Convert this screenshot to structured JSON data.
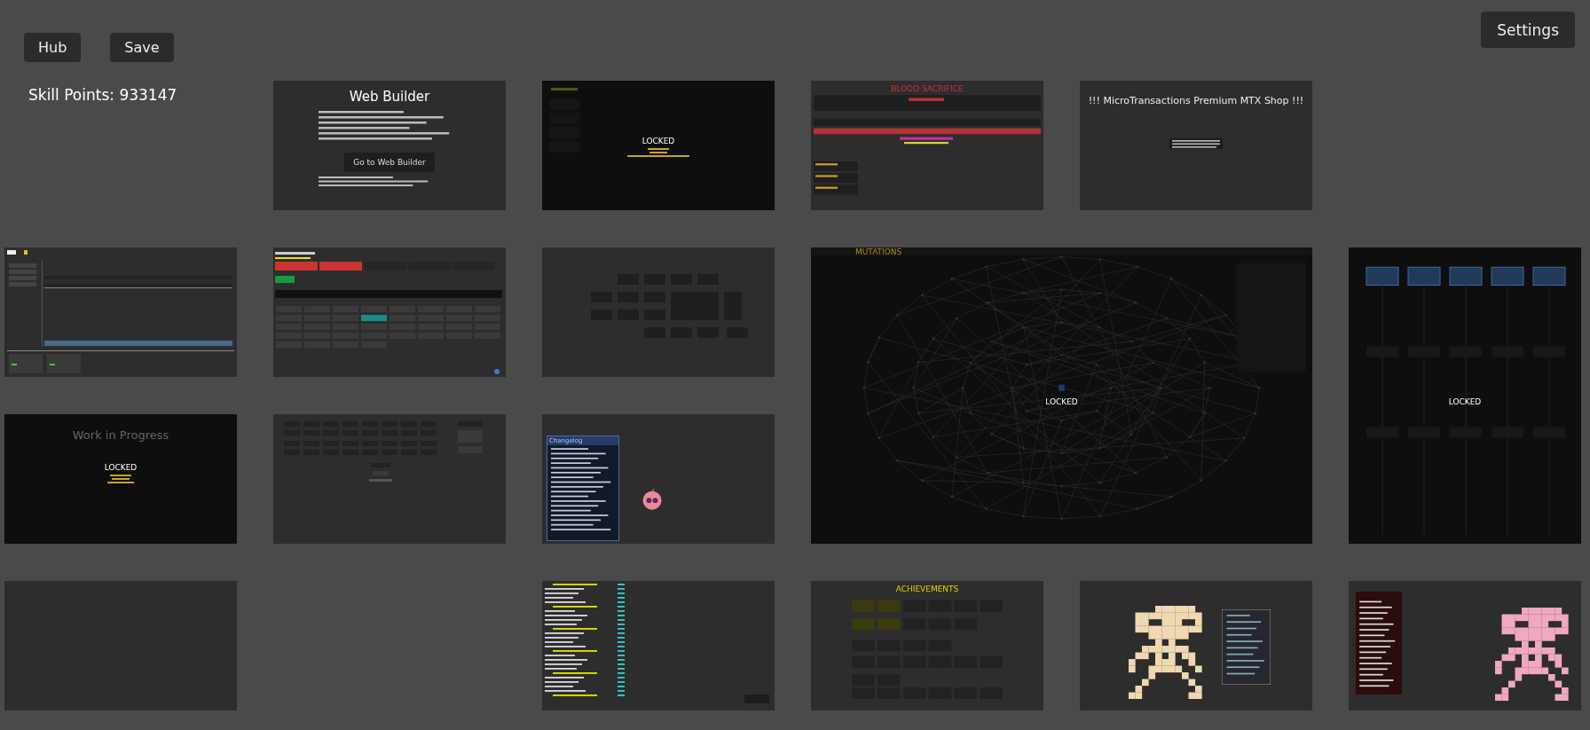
{
  "toolbar": {
    "buttons": [
      "Hub",
      "Save"
    ],
    "settings": "Settings"
  },
  "skill_points": "Skill Points: 933147",
  "pages": [
    {
      "kind": "builder",
      "title": "Web Builder",
      "button": "Go to Web Builder"
    },
    {
      "kind": "prestige",
      "status": "LOCKED"
    },
    {
      "kind": "sacrifice",
      "title": "BLOOD SACRIFICE"
    },
    {
      "kind": "shop",
      "title": "!!! MicroTransactions Premium MTX Shop !!!"
    },
    {
      "kind": "form"
    },
    {
      "kind": "shopgrid"
    },
    {
      "kind": "nodes"
    },
    {
      "kind": "graph",
      "title": "MUTATIONS",
      "status": "LOCKED"
    },
    {
      "kind": "columns",
      "status": "LOCKED"
    },
    {
      "kind": "wip",
      "title": "Work in Progress",
      "status": "LOCKED"
    },
    {
      "kind": "grid"
    },
    {
      "kind": "changelog",
      "title": "Changelog"
    },
    {
      "kind": "empty"
    },
    {
      "kind": "textlist"
    },
    {
      "kind": "achievements",
      "title": "ACHIEVEMENTS"
    },
    {
      "kind": "skeleton"
    },
    {
      "kind": "pinkskeleton"
    }
  ]
}
